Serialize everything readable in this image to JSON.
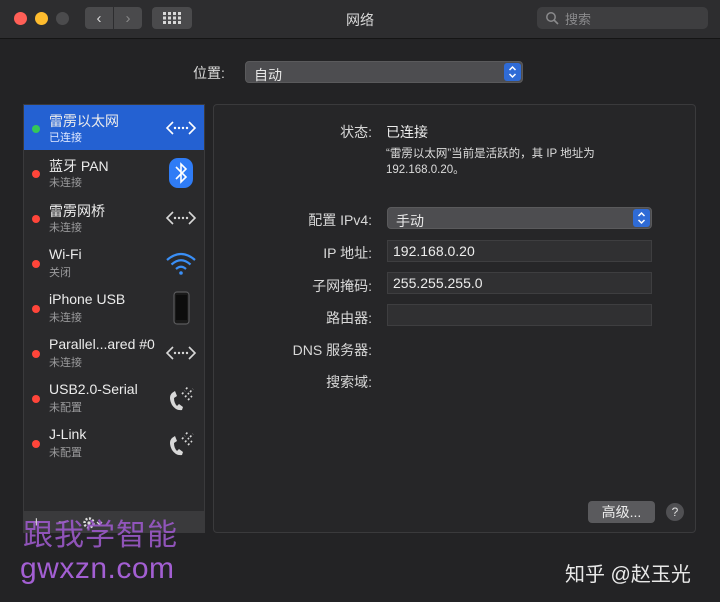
{
  "window": {
    "title": "网络"
  },
  "search": {
    "placeholder": "搜索"
  },
  "location": {
    "label": "位置:",
    "value": "自动"
  },
  "services": [
    {
      "name": "雷雳以太网",
      "status": "已连接",
      "dot": "#34c759",
      "icon": "ethernet-arrows-icon",
      "selected": true
    },
    {
      "name": "蓝牙 PAN",
      "status": "未连接",
      "dot": "#ff453a",
      "icon": "bluetooth-icon"
    },
    {
      "name": "雷雳网桥",
      "status": "未连接",
      "dot": "#ff453a",
      "icon": "ethernet-arrows-icon"
    },
    {
      "name": "Wi-Fi",
      "status": "关闭",
      "dot": "#ff453a",
      "icon": "wifi-icon"
    },
    {
      "name": "iPhone USB",
      "status": "未连接",
      "dot": "#ff453a",
      "icon": "iphone-icon"
    },
    {
      "name": "Parallel...ared #0",
      "status": "未连接",
      "dot": "#ff453a",
      "icon": "ethernet-arrows-icon"
    },
    {
      "name": "USB2.0-Serial",
      "status": "未配置",
      "dot": "#ff453a",
      "icon": "phone-modem-icon"
    },
    {
      "name": "J-Link",
      "status": "未配置",
      "dot": "#ff453a",
      "icon": "phone-modem-icon"
    }
  ],
  "sidebar_controls": {
    "add": "+",
    "remove": "−"
  },
  "detail": {
    "status_label": "状态:",
    "status_value": "已连接",
    "description_line1": "“雷雳以太网”当前是活跃的，其 IP 地址为",
    "description_line2": "192.168.0.20。",
    "config_label": "配置 IPv4:",
    "config_value": "手动",
    "ip_label": "IP 地址:",
    "ip_value": "192.168.0.20",
    "mask_label": "子网掩码:",
    "mask_value": "255.255.255.0",
    "router_label": "路由器:",
    "router_value": "",
    "dns_label": "DNS 服务器:",
    "search_domain_label": "搜索域:",
    "advanced_button": "高级...",
    "help_button": "?"
  },
  "watermarks": {
    "line1": "跟我学智能",
    "line2": "gwxzn.com",
    "zhihu": "知乎 @赵玉光"
  },
  "colors": {
    "accent": "#2461d2",
    "connected": "#34c759",
    "disconnected": "#ff453a"
  }
}
